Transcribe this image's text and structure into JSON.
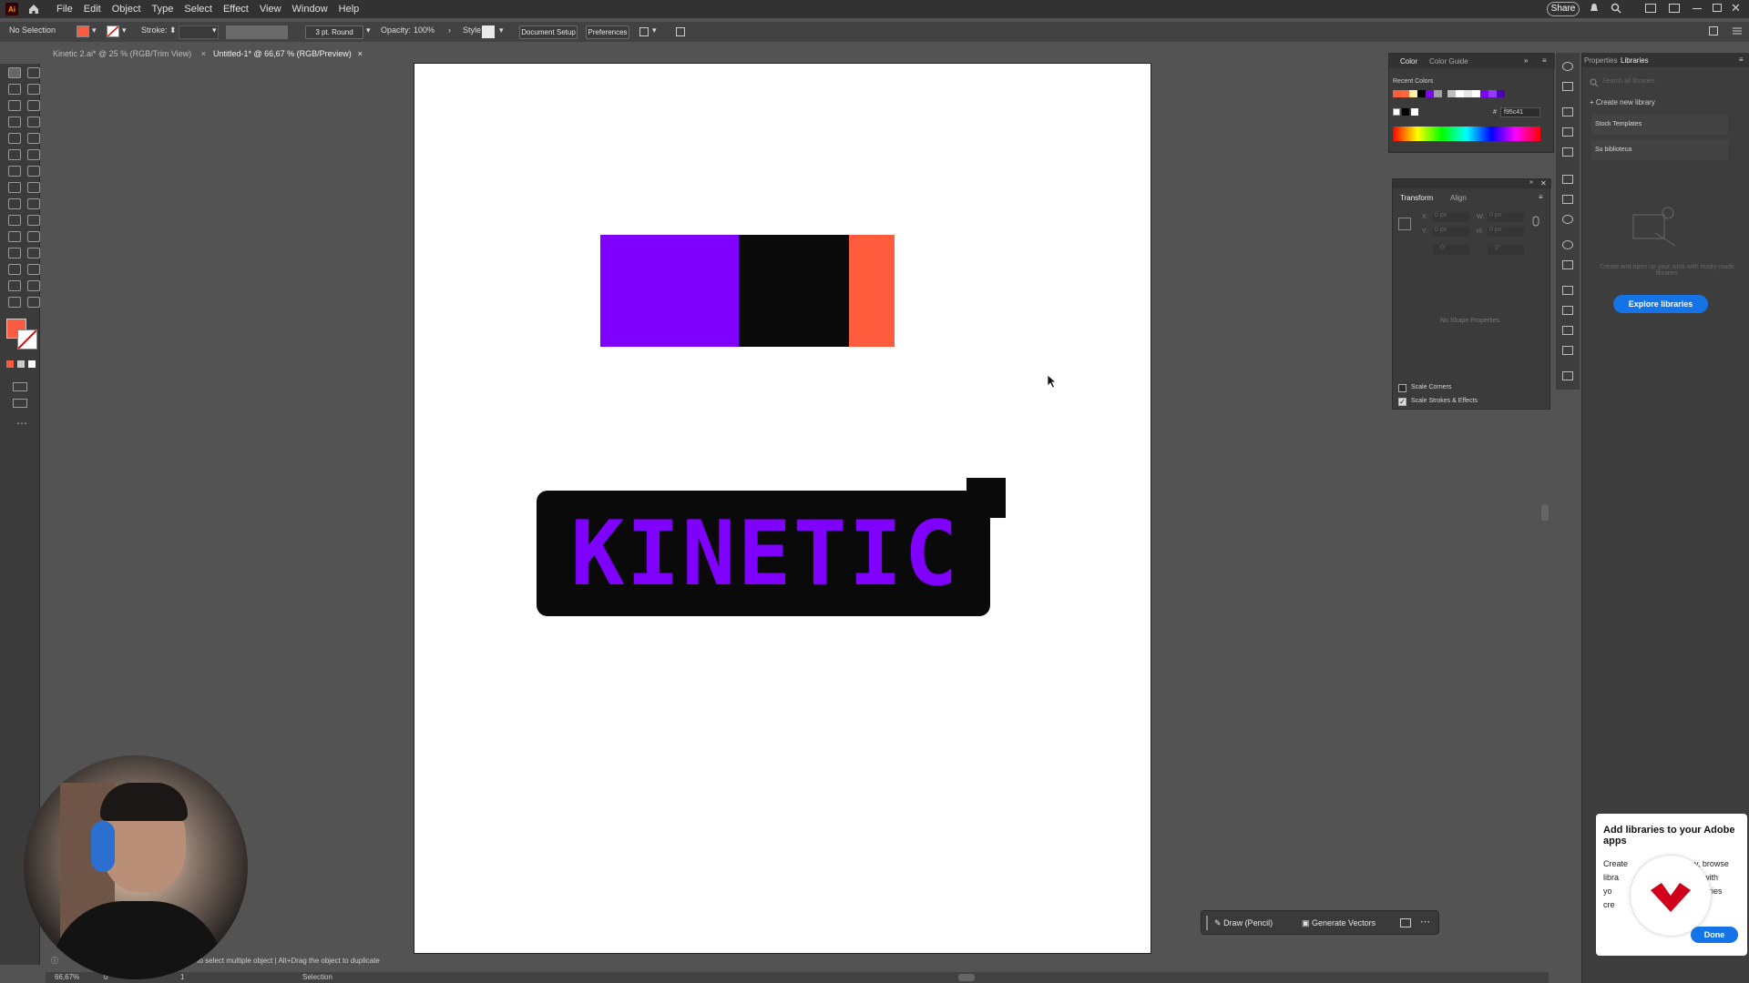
{
  "app": {
    "logo": "Ai",
    "menus": [
      "File",
      "Edit",
      "Object",
      "Type",
      "Select",
      "Effect",
      "View",
      "Window",
      "Help"
    ],
    "share_label": "Share"
  },
  "controlbar": {
    "selection_label": "No Selection",
    "stroke_label": "Stroke:",
    "brush_label": "3 pt. Round",
    "opacity_label": "Opacity:",
    "opacity_value": "100%",
    "style_label": "Style:",
    "doc_setup_label": "Document Setup",
    "preferences_label": "Preferences"
  },
  "tabs": [
    {
      "label": "Kinetic 2.ai* @ 25 % (RGB/Trim View)",
      "close": "×"
    },
    {
      "label": "Untitled-1* @ 66,67 % (RGB/Preview)",
      "close": "×"
    }
  ],
  "artboard": {
    "swatches": [
      "#7f00ff",
      "#0a0a0a",
      "#ff5c3d"
    ],
    "logo_text": "KINETIC",
    "logo_text_color": "#7f00ff",
    "logo_bg_color": "#0a0a0a"
  },
  "color_panel": {
    "tab_color": "Color",
    "tab_guide": "Color Guide",
    "recent_label": "Recent Colors",
    "hex_label": "#",
    "hex_value": "f95c41",
    "recent_colors": [
      "#f95c41",
      "#ff6a3d",
      "#fff2a6",
      "#000000",
      "#7f00ff",
      "#a0a0a0",
      "#bdbdbd",
      "#ffffff",
      "#e6e6e6",
      "#ffffff",
      "#7f00ff",
      "#8e3bff",
      "#4b00b3"
    ]
  },
  "transform_panel": {
    "tab_transform": "Transform",
    "tab_align": "Align",
    "x_label": "X:",
    "x_value": "0 px",
    "y_label": "Y:",
    "y_value": "0 px",
    "w_label": "W:",
    "w_value": "0 px",
    "h_label": "H:",
    "h_value": "0 px",
    "angle_value": "0°",
    "shear_value": "0°",
    "no_shape": "No Shape Properties",
    "scale_corners": "Scale Corners",
    "scale_strokes": "Scale Strokes & Effects",
    "scale_corners_checked": false,
    "scale_strokes_checked": true
  },
  "library_panel": {
    "tab_properties": "Properties",
    "tab_libraries": "Libraries",
    "search_placeholder": "Search all libraries",
    "create_label": "Create new library",
    "items": [
      "Stock Templates",
      "Su biblioteca"
    ],
    "empty_text": "Create and open up your work with ready-made libraries",
    "explore_label": "Explore libraries"
  },
  "draw_bar": {
    "draw_label": "Draw (Pencil)",
    "generate_label": "Generate Vectors"
  },
  "popup": {
    "title": "Add libraries to your Adobe apps",
    "body_lines": [
      "Create",
      "libra",
      "yo",
      "cre"
    ],
    "body_right": [
      "y, browse",
      "with",
      "raries"
    ],
    "done_label": "Done"
  },
  "status": {
    "zoom": "66,67%",
    "angle": "0°",
    "artboard_num": "1",
    "tool_label": "Selection",
    "hint": "to select multiple object  |  Alt+Drag the object to duplicate"
  },
  "colors": {
    "fill": "#f95c41",
    "accent_blue": "#1473e6"
  }
}
